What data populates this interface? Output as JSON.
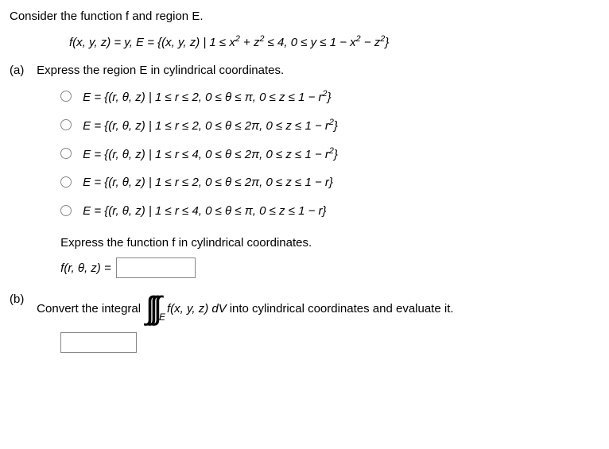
{
  "intro": "Consider the function f and region E.",
  "definition_html": "f(x, y, z) = y, E = {(x, y, z) | 1 ≤ x<sup>2</sup> + z<sup>2</sup> ≤ 4, 0 ≤ y ≤ 1 − x<sup>2</sup> − z<sup>2</sup>}",
  "partA": {
    "label": "(a)",
    "prompt": "Express the region E in cylindrical coordinates.",
    "options": [
      "E = {(r, θ, z) | 1 ≤ r ≤ 2, 0 ≤ θ ≤ π, 0 ≤ z ≤ 1 − r<sup>2</sup>}",
      "E = {(r, θ, z) | 1 ≤ r ≤ 2, 0 ≤ θ ≤ 2π, 0 ≤ z ≤ 1 − r<sup>2</sup>}",
      "E = {(r, θ, z) | 1 ≤ r ≤ 4, 0 ≤ θ ≤ 2π, 0 ≤ z ≤ 1 − r<sup>2</sup>}",
      "E = {(r, θ, z) | 1 ≤ r ≤ 2, 0 ≤ θ ≤ 2π, 0 ≤ z ≤ 1 − r}",
      "E = {(r, θ, z) | 1 ≤ r ≤ 4, 0 ≤ θ ≤ π, 0 ≤ z ≤ 1 − r}"
    ],
    "sub_prompt": "Express the function f in cylindrical coordinates.",
    "fn_label": "f(r, θ, z) ="
  },
  "partB": {
    "label": "(b)",
    "lead": "Convert the integral",
    "integral_sub": "E",
    "integrand": "f(x, y, z) dV",
    "tail": "into cylindrical coordinates and evaluate it."
  }
}
